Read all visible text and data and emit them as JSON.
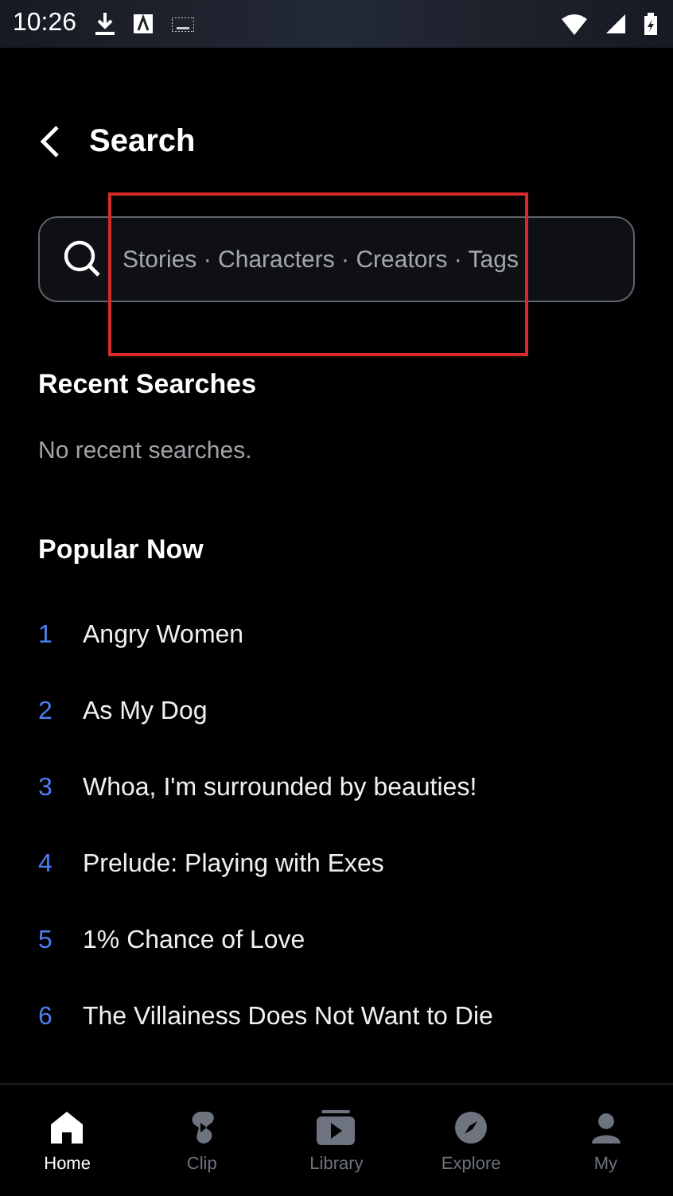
{
  "status_bar": {
    "time": "10:26"
  },
  "header": {
    "title": "Search"
  },
  "search": {
    "placeholder": "Stories · Characters · Creators · Tags"
  },
  "recent": {
    "title": "Recent Searches",
    "empty_text": "No recent searches."
  },
  "popular": {
    "title": "Popular Now",
    "items": [
      {
        "rank": "1",
        "title": "Angry Women"
      },
      {
        "rank": "2",
        "title": "As My Dog"
      },
      {
        "rank": "3",
        "title": "Whoa, I'm surrounded by beauties!"
      },
      {
        "rank": "4",
        "title": "Prelude: Playing with Exes"
      },
      {
        "rank": "5",
        "title": "1% Chance of Love"
      },
      {
        "rank": "6",
        "title": "The Villainess Does Not Want to Die"
      }
    ]
  },
  "annotation": {
    "kind": "box"
  },
  "nav": [
    {
      "kind": "home",
      "label": "Home",
      "selected": true
    },
    {
      "kind": "clip",
      "label": "Clip",
      "selected": false
    },
    {
      "kind": "library",
      "label": "Library",
      "selected": false
    },
    {
      "kind": "explore",
      "label": "Explore",
      "selected": false
    },
    {
      "kind": "my",
      "label": "My",
      "selected": false
    }
  ]
}
